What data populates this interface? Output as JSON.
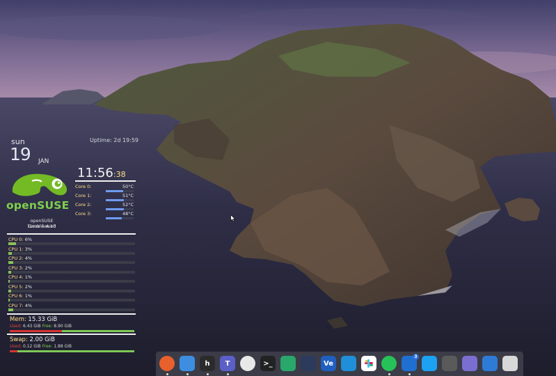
{
  "conky": {
    "day": "sun",
    "date": "19",
    "month": "JAN",
    "uptime": "Uptime: 2d 19:59",
    "clock_hm": "11:",
    "clock_min": "56",
    "clock_sec": ":38",
    "logo_text": "openSUSE",
    "distro": "openSUSE Tumbleweed",
    "kernel": "Linux 5.4.10",
    "cores": [
      {
        "label": "Core 0:",
        "temp": "50°C",
        "level": 0.62
      },
      {
        "label": "Core 1:",
        "temp": "51°C",
        "level": 0.64
      },
      {
        "label": "Core 2:",
        "temp": "52°C",
        "level": 0.65
      },
      {
        "label": "Core 3:",
        "temp": "48°C",
        "level": 0.58
      }
    ],
    "cpus": [
      {
        "label": "CPU 0:",
        "pct": "6%",
        "level": 0.06
      },
      {
        "label": "CPU 1:",
        "pct": "3%",
        "level": 0.03
      },
      {
        "label": "CPU 2:",
        "pct": "4%",
        "level": 0.04
      },
      {
        "label": "CPU 3:",
        "pct": "2%",
        "level": 0.02
      },
      {
        "label": "CPU 4:",
        "pct": "1%",
        "level": 0.01
      },
      {
        "label": "CPU 5:",
        "pct": "2%",
        "level": 0.02
      },
      {
        "label": "CPU 6:",
        "pct": "1%",
        "level": 0.01
      },
      {
        "label": "CPU 7:",
        "pct": "4%",
        "level": 0.04
      }
    ],
    "mem": {
      "title": "Mem:",
      "total": "15.33 GiB",
      "used_label": "Used:",
      "used": "6.43 GiB",
      "free_label": "Free:",
      "free": "8.90 GiB",
      "used_fraction": 0.42
    },
    "swap": {
      "title": "Swap:",
      "total": "2.00 GiB",
      "used_label": "Used:",
      "used": "0.12 GiB",
      "free_label": "Free:",
      "free": "1.88 GiB",
      "used_fraction": 0.06
    }
  },
  "dock": {
    "items": [
      {
        "name": "firefox-icon",
        "glyph": "",
        "color": "#e8602c"
      },
      {
        "name": "finder-icon",
        "glyph": "",
        "color": "#3d8ee0"
      },
      {
        "name": "hyper-icon",
        "glyph": "h",
        "color": "#2b2b2b"
      },
      {
        "name": "teams-icon",
        "glyph": "T",
        "color": "#5b5fc7"
      },
      {
        "name": "vpn-icon",
        "glyph": "",
        "color": "#e8e8e8"
      },
      {
        "name": "terminal-icon",
        "glyph": ">_",
        "color": "#222"
      },
      {
        "name": "mastodon-icon",
        "glyph": "",
        "color": "#2aa76a"
      },
      {
        "name": "rocket-icon",
        "glyph": "",
        "color": "#2c3a5c"
      },
      {
        "name": "veracrypt-icon",
        "glyph": "Ve",
        "color": "#1f5fc0"
      },
      {
        "name": "vscode-icon",
        "glyph": "",
        "color": "#1e8fd8"
      },
      {
        "name": "slack-icon",
        "glyph": "",
        "color": "#ffffff"
      },
      {
        "name": "whatsapp-icon",
        "glyph": "",
        "color": "#26c259"
      },
      {
        "name": "thunderbird-icon",
        "glyph": "",
        "color": "#1f6fd0",
        "badge": "3"
      },
      {
        "name": "virtualbox-icon",
        "glyph": "",
        "color": "#1da1f2"
      },
      {
        "name": "settings-icon",
        "glyph": "",
        "color": "#5a5a5a"
      },
      {
        "name": "workspace-icon",
        "glyph": "",
        "color": "#7a6fd0"
      },
      {
        "name": "downloads-icon",
        "glyph": "",
        "color": "#2e7bd6"
      },
      {
        "name": "trash-icon",
        "glyph": "",
        "color": "#d8d8d8"
      }
    ]
  }
}
